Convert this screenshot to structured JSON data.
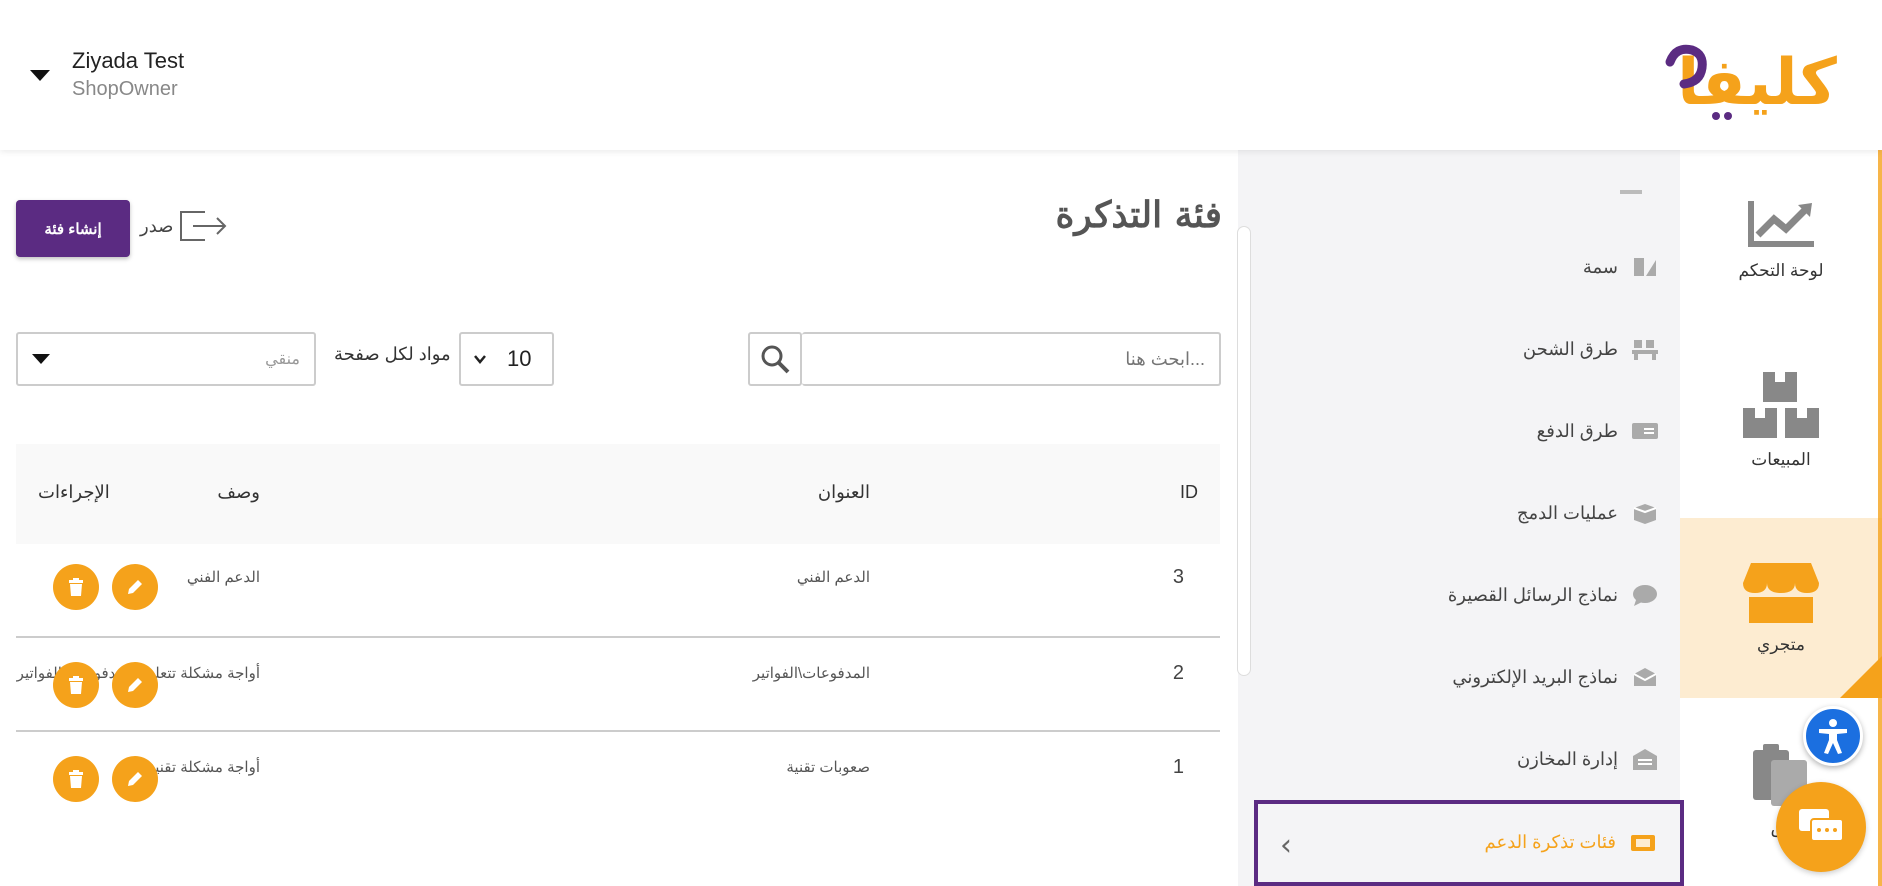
{
  "header": {
    "user_name": "Ziyada Test",
    "user_role": "ShopOwner",
    "logo_text": "كليفا"
  },
  "rail": {
    "items": [
      {
        "label": "لوحة التحكم",
        "icon": "chart-trend-icon"
      },
      {
        "label": "المبيعات",
        "icon": "boxes-icon"
      },
      {
        "label": "متجري",
        "icon": "store-icon",
        "active": true
      },
      {
        "label": "س",
        "icon": "clipboard-icon"
      }
    ]
  },
  "submenu": {
    "items": [
      {
        "label": "سمة",
        "icon": "theme-icon"
      },
      {
        "label": "طرق الشحن",
        "icon": "shipping-icon"
      },
      {
        "label": "طرق الدفع",
        "icon": "payment-icon"
      },
      {
        "label": "عمليات الدمج",
        "icon": "integration-icon"
      },
      {
        "label": "نماذج الرسائل القصيرة",
        "icon": "sms-icon"
      },
      {
        "label": "نماذج البريد الإلكتروني",
        "icon": "email-icon"
      },
      {
        "label": "إدارة المخازن",
        "icon": "warehouse-icon"
      }
    ],
    "active_label": "فئات تذكرة الدعم"
  },
  "main": {
    "title": "فئة التذكرة",
    "create_button": "إنشاء فئة",
    "export_label": "صدر",
    "search_placeholder": "...ابحث هنا",
    "per_page_label": "مواد لكل صفحة",
    "per_page_value": "10",
    "filter_placeholder": "منقي"
  },
  "table": {
    "headers": {
      "id": "ID",
      "title": "العنوان",
      "description": "وصف",
      "actions": "الإجراءات"
    },
    "rows": [
      {
        "id": "3",
        "title": "الدعم الفني",
        "description": "الدعم الفني"
      },
      {
        "id": "2",
        "title": "المدفوعات\\الفواتير",
        "description": "أواجة مشكلة تتعلق بالمدفوعات\\الفواتير"
      },
      {
        "id": "1",
        "title": "صعوبات تقنية",
        "description": "أواجة مشكلة تقنية"
      }
    ]
  },
  "colors": {
    "brand_purple": "#5b2b82",
    "accent_orange": "#f5a21b"
  }
}
